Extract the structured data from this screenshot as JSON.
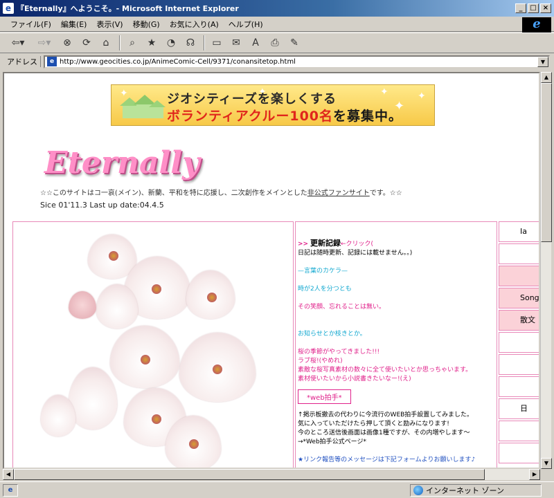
{
  "window": {
    "title": "『Eternally』へようこそ。- Microsoft Internet Explorer"
  },
  "menu": [
    "ファイル(F)",
    "編集(E)",
    "表示(V)",
    "移動(G)",
    "お気に入り(A)",
    "ヘルプ(H)"
  ],
  "address": {
    "label": "アドレス",
    "url": "http://www.geocities.co.jp/AnimeComic-Cell/9371/conansitetop.html"
  },
  "banner": {
    "line1": "ジオシティーズを楽しくする",
    "line2a": "ボランティアクルー",
    "line2b": "100名",
    "line2c": "を募集中。"
  },
  "site": {
    "logo": "Eternally",
    "tagline_pre": "☆☆このサイトはコ一哀(メイン)、新蘭、平和を特に応援し、二次創作をメインとした",
    "tagline_link": "非公式ファンサイト",
    "tagline_post": "です。☆☆",
    "updated": "Sice 01'11.3 Last up date:04.4.5"
  },
  "update_panel": {
    "arrows": ">>",
    "heading": "更新記録",
    "click_label": "←クリック(",
    "note": "日記は随時更新、記録には載せません。。)",
    "lines": [
      {
        "text": "—言葉のカケラ—",
        "color": "cyan"
      },
      {
        "text": "時が2人を分つとも",
        "color": "cyan"
      },
      {
        "text": "その笑顔、忘れることは無い。",
        "color": "pink"
      },
      {
        "text": "お知らせとか枝きとか。",
        "color": "cyan"
      },
      {
        "text": "桜の季節がやってきました!!!",
        "color": "pink"
      },
      {
        "text": "ラブ桜!(やめれ)",
        "color": "pink"
      },
      {
        "text": "素敵な桜写真素材の数々に全て使いたいとか思っちゃいます。",
        "color": "pink"
      },
      {
        "text": "素材使いたいから小説書きたいなー!(え)",
        "color": "pink"
      }
    ],
    "web_clap": "*web拍手*",
    "clap_lines": [
      "↑掲示板撤去の代わりに今流行のWEB拍手設置してみました。",
      "気に入っていただけたら押して頂くと励みになります!",
      "今のところ送信後画面は画像1種ですが、その内増やします〜",
      "→*Web拍手公式ページ*"
    ],
    "link_note": "★リンク報告等のメッセージは下記フォームよりお願いします♪"
  },
  "right_nav": [
    "Ia",
    "",
    "",
    "Songl",
    "散文",
    "",
    "",
    "",
    "日",
    "",
    ""
  ],
  "status": {
    "zone": "インターネット ゾーン"
  }
}
